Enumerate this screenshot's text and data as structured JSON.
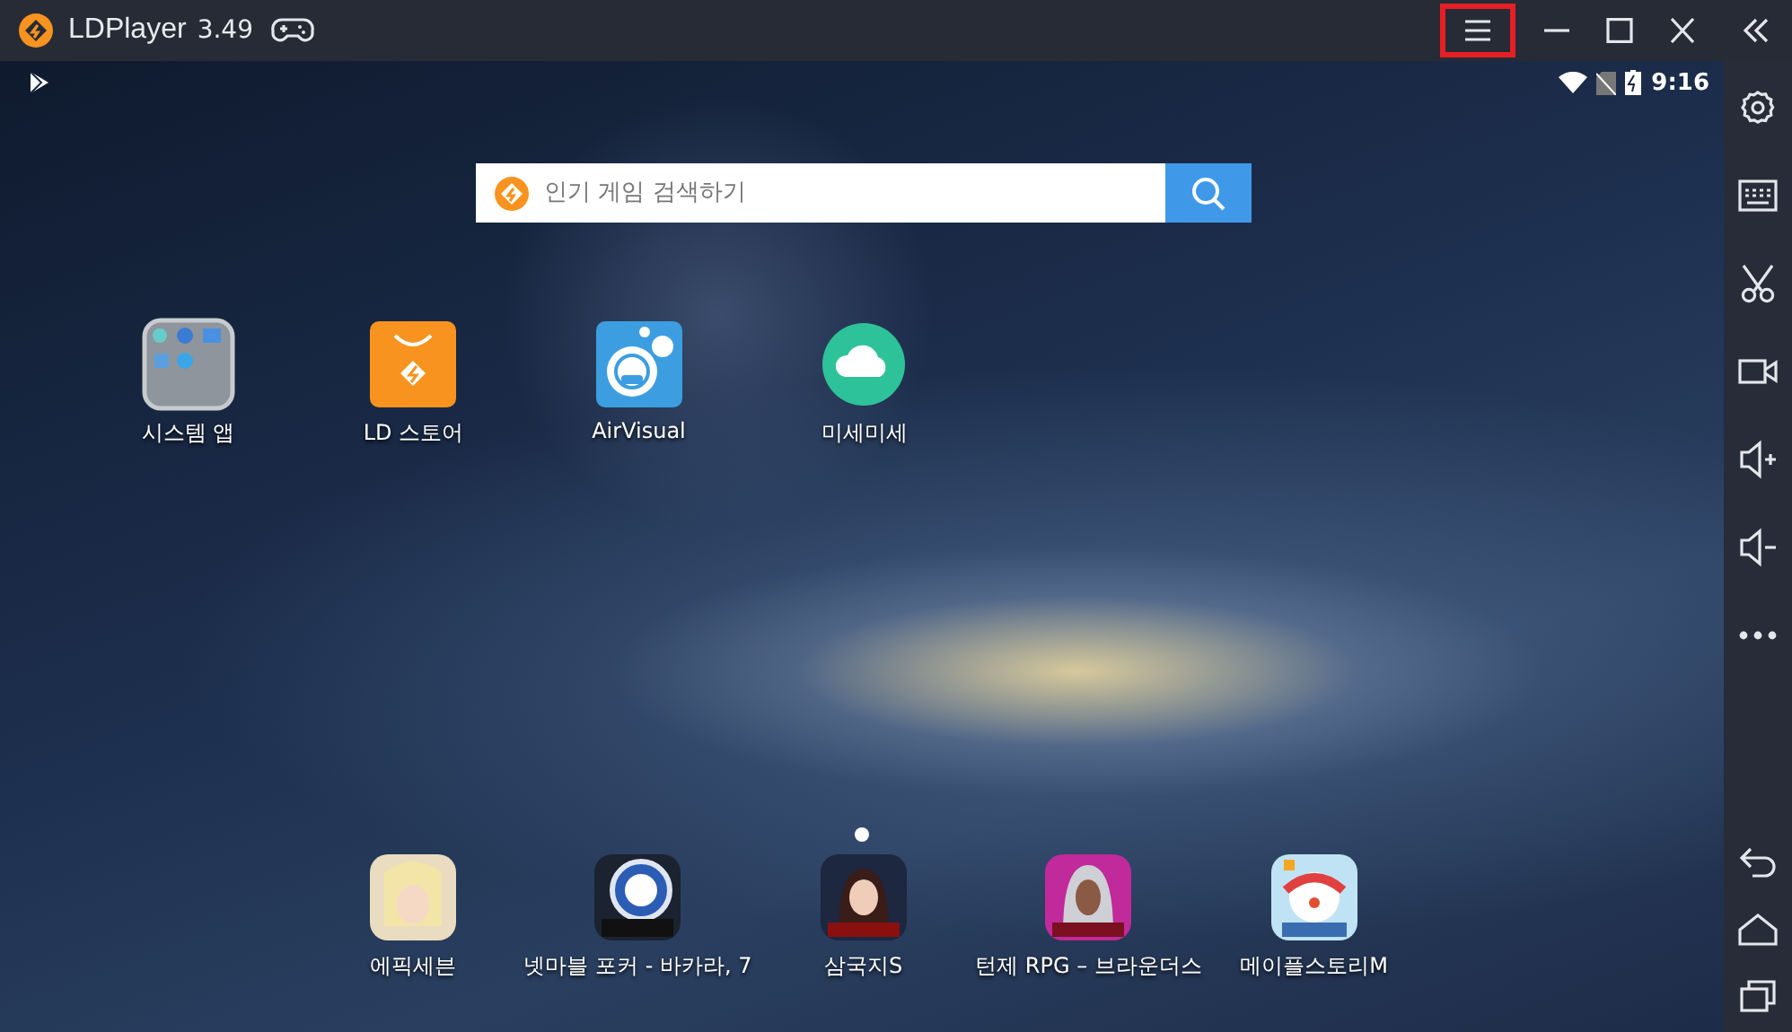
{
  "title_bar": {
    "app_name": "LDPlayer",
    "version": "3.49",
    "buttons": [
      {
        "kind": "gamepad",
        "highlighted": false
      },
      {
        "kind": "menu",
        "highlighted": true
      },
      {
        "kind": "minimize",
        "highlighted": false
      },
      {
        "kind": "maximize",
        "highlighted": false
      },
      {
        "kind": "close",
        "highlighted": false
      },
      {
        "kind": "collapse",
        "highlighted": false
      }
    ]
  },
  "status_bar": {
    "time": "9:16"
  },
  "search": {
    "placeholder": "인기 게임 검색하기"
  },
  "apps": [
    {
      "label": "시스템 앱",
      "kind": "folder"
    },
    {
      "label": "LD 스토어",
      "kind": "store"
    },
    {
      "label": "AirVisual",
      "kind": "airvisual"
    },
    {
      "label": "미세미세",
      "kind": "cloud"
    }
  ],
  "page_indicator": [
    {
      "selected": true
    }
  ],
  "dock": [
    {
      "label": "에픽세븐",
      "kind": "game-blond"
    },
    {
      "label": "넷마블 포커 - 바카라, 7",
      "kind": "game-poker"
    },
    {
      "label": "삼국지S",
      "kind": "game-dark"
    },
    {
      "label": "턴제 RPG – 브라운더스",
      "kind": "game-pink"
    },
    {
      "label": "메이플스토리M",
      "kind": "game-maple"
    }
  ],
  "sidebar": {
    "tools": [
      {
        "kind": "settings"
      },
      {
        "kind": "keyboard"
      },
      {
        "kind": "scissors"
      },
      {
        "kind": "video"
      },
      {
        "kind": "volume-up"
      },
      {
        "kind": "volume-down"
      },
      {
        "kind": "more"
      }
    ],
    "nav": [
      {
        "kind": "back"
      },
      {
        "kind": "home"
      },
      {
        "kind": "recent"
      }
    ]
  }
}
